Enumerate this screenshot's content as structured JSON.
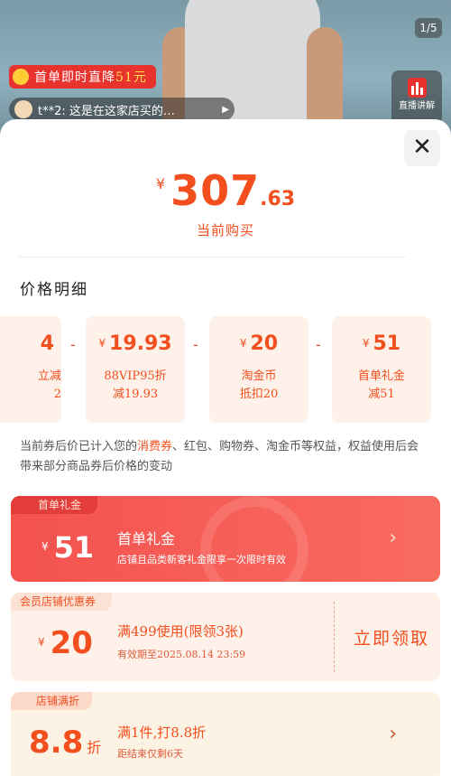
{
  "video": {
    "page_indicator": "1/5",
    "promo_tag": {
      "prefix": "首单即时直降",
      "amount": "51元"
    },
    "comment": "t**2: 这是在这家店买的…",
    "live_label": "直播讲解"
  },
  "sheet": {
    "close_symbol": "✕",
    "price": {
      "currency": "¥",
      "integer": "307",
      "decimal": ".63",
      "label": "当前购买"
    },
    "section_title": "价格明细",
    "breakdown": [
      {
        "amount": "4",
        "line1": "立减",
        "line2": "2"
      },
      {
        "amount": "19.93",
        "line1": "88VIP95折",
        "line2": "减19.93"
      },
      {
        "amount": "20",
        "line1": "淘金币",
        "line2": "抵扣20"
      },
      {
        "amount": "51",
        "line1": "首单礼金",
        "line2": "减51"
      }
    ],
    "minus_symbol": "-",
    "note": {
      "part1": "当前券后价已计入您的",
      "highlight": "消费券",
      "part2": "、红包、购物券、淘金币等权益，权益使用后会带来部分商品券后价格的变动"
    },
    "coupons": {
      "first_order": {
        "tag": "首单礼金",
        "currency": "¥",
        "amount": "51",
        "title": "首单礼金",
        "desc": "店铺且品类新客礼金限享一次限时有效",
        "arrow": "›"
      },
      "member": {
        "tag": "会员店铺优惠券",
        "currency": "¥",
        "amount": "20",
        "title": "满499使用(限领3张)",
        "desc": "有效期至2025.08.14 23:59",
        "action": "立即领取"
      },
      "discount": {
        "tag": "店铺满折",
        "amount": "8.8",
        "unit": "折",
        "title": "满1件,打8.8折",
        "desc": "距结束仅剩6天",
        "arrow": "›"
      }
    }
  },
  "colors": {
    "accent": "#f24e1e",
    "coupon_red": "#f4524f",
    "coupon_bg": "#fdf1ea"
  }
}
